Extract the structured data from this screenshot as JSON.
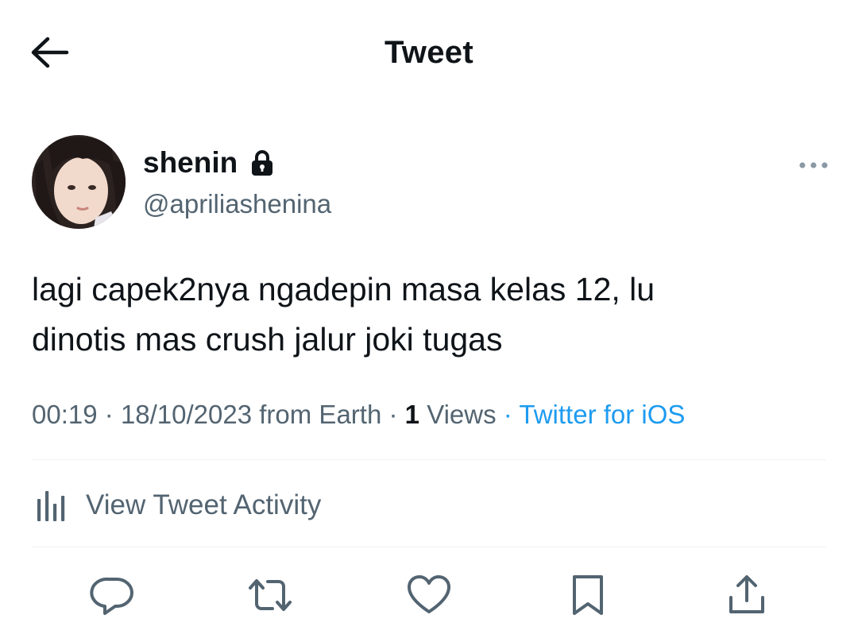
{
  "header": {
    "title": "Tweet"
  },
  "author": {
    "display_name": "shenin",
    "handle": "@apriliashenina"
  },
  "tweet": {
    "text_line1": "lagi capek2nya ngadepin masa kelas 12, lu",
    "text_line2": "dinotis mas crush jalur joki tugas",
    "time": "00:19",
    "separator": "·",
    "date": "18/10/2023 from Earth",
    "views_count": "1",
    "views_label": "Views",
    "source": "Twitter for iOS"
  },
  "activity": {
    "label": "View Tweet Activity"
  },
  "icons": {
    "back": "arrow-left-icon",
    "lock": "lock-icon",
    "more": "more-horizontal-icon",
    "activity": "bar-chart-icon",
    "reply": "reply-icon",
    "retweet": "retweet-icon",
    "like": "heart-icon",
    "bookmark": "bookmark-icon",
    "share": "share-icon"
  },
  "colors": {
    "text": "#0f1419",
    "secondary": "#536471",
    "link": "#1d9bf0",
    "divider": "#eff3f4"
  }
}
